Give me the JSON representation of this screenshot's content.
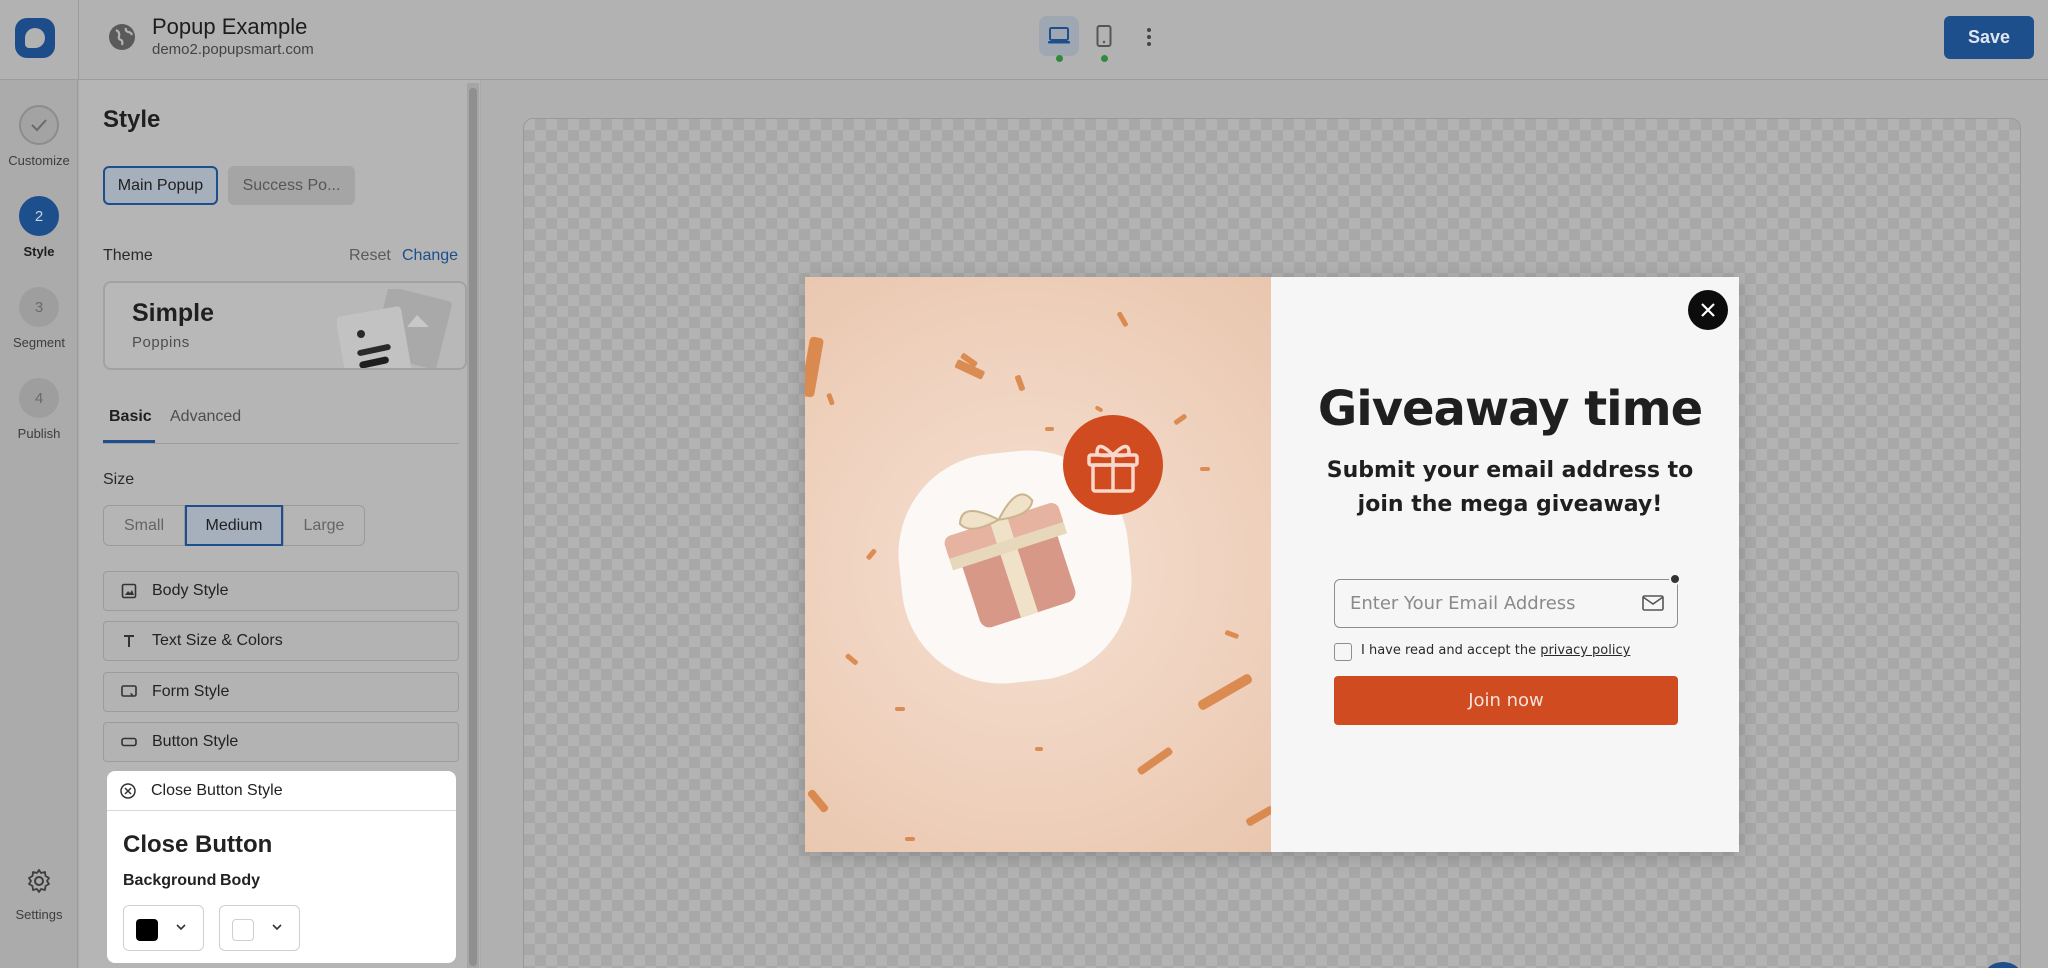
{
  "header": {
    "title": "Popup Example",
    "url": "demo2.popupsmart.com",
    "save_label": "Save",
    "devices": [
      {
        "name": "desktop-icon",
        "active": true
      },
      {
        "name": "mobile-icon",
        "active": false
      }
    ]
  },
  "rail": {
    "steps": [
      {
        "label": "Customize",
        "number": "",
        "status": "done"
      },
      {
        "label": "Style",
        "number": "2",
        "status": "current"
      },
      {
        "label": "Segment",
        "number": "3",
        "status": "todo"
      },
      {
        "label": "Publish",
        "number": "4",
        "status": "todo"
      }
    ],
    "settings_label": "Settings"
  },
  "panel": {
    "title": "Style",
    "popup_tabs": [
      "Main Popup",
      "Success Po..."
    ],
    "theme": {
      "label": "Theme",
      "reset": "Reset",
      "change": "Change",
      "name": "Simple",
      "font": "Poppins"
    },
    "tabs": [
      "Basic",
      "Advanced"
    ],
    "size": {
      "label": "Size",
      "options": [
        "Small",
        "Medium",
        "Large"
      ],
      "selected": "Medium"
    },
    "sections": [
      "Body Style",
      "Text Size & Colors",
      "Form Style",
      "Button Style",
      "Close Button Style"
    ],
    "close_button": {
      "title": "Close Button",
      "background_label": "Background",
      "body_label": "Body",
      "background_color": "#000000",
      "body_color": "#ffffff"
    }
  },
  "popup": {
    "headline": "Giveaway time",
    "subheadline_line1": "Submit your email address to",
    "subheadline_line2": "join the mega giveaway!",
    "email_placeholder": "Enter Your Email Address",
    "consent_text": "I have read and accept the ",
    "consent_link": "privacy policy",
    "cta_label": "Join now",
    "accent_color": "#d04b20"
  }
}
